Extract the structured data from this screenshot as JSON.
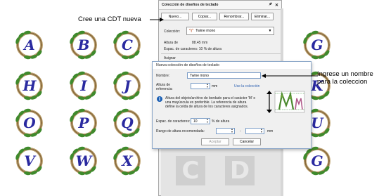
{
  "wreaths": [
    {
      "letter": "A"
    },
    {
      "letter": "B"
    },
    {
      "letter": "C"
    },
    {
      "letter": "G"
    },
    {
      "letter": "H"
    },
    {
      "letter": "I"
    },
    {
      "letter": "J"
    },
    {
      "letter": "K"
    },
    {
      "letter": "O"
    },
    {
      "letter": "P"
    },
    {
      "letter": "Q"
    },
    {
      "letter": "U"
    },
    {
      "letter": "V"
    },
    {
      "letter": "W"
    },
    {
      "letter": "X"
    },
    {
      "letter": "G"
    }
  ],
  "colors": {
    "wreath_vine": "#8a6a3a",
    "leaf": "#3f8a2c",
    "letter": "#2a2aa0",
    "dialog_border": "#8aa6c8",
    "link": "#2b5fb0"
  },
  "panel": {
    "title": "Colección de diseños de teclado",
    "pin_icon": "pin-icon",
    "close_icon": "close-icon",
    "buttons": {
      "new": "Nuevo...",
      "copy": "Copiar...",
      "rename": "Renombrar...",
      "delete": "Eliminar..."
    },
    "collection_label": "Colección:",
    "collection_value": "Twine mono",
    "height_label": "Altura de",
    "height_value": "88.45 mm",
    "spacing_text": "Espac. de caracteres: 10 % de altura",
    "assign_label": "Asignar",
    "big_letters": [
      "C",
      "D"
    ]
  },
  "dialog": {
    "title": "Nueva colección de diseños de teclado",
    "name_label": "Nombre:",
    "name_value": "Twine mono",
    "ref_height_label_1": "Altura de",
    "ref_height_label_2": "referencia:",
    "ref_height_unit": "mm",
    "use_collection_link": "Use la colección",
    "info_text_1": "Altura del objeto/archivo de bordado para el carácter 'M' o",
    "info_text_2": "una mayúscula es preferible. La referencia de altura",
    "info_text_3": "define la celda de altura de los caracteres asignados.",
    "spacing_label": "Espac. de caracteres:",
    "spacing_value": "10",
    "spacing_unit": "% de altura",
    "range_label": "Rango de altura recomendada:",
    "range_sep": "-",
    "range_unit": "mm",
    "ok_label": "Aceptar",
    "cancel_label": "Cancelar"
  },
  "callouts": {
    "left": "Cree una CDT nueva",
    "right": "Ingrese un nombre para la coleccion"
  }
}
